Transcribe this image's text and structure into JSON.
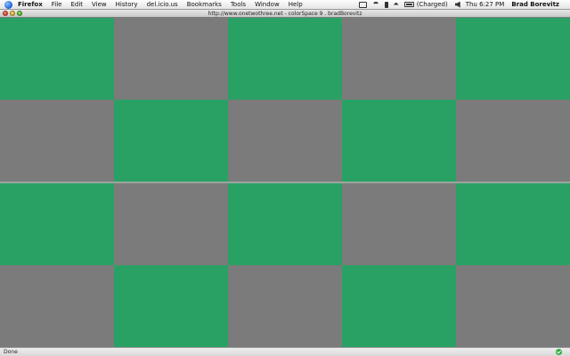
{
  "menubar": {
    "app": "Firefox",
    "items": [
      "File",
      "Edit",
      "View",
      "History",
      "del.icio.us",
      "Bookmarks",
      "Tools",
      "Window",
      "Help"
    ],
    "battery_status": "(Charged)",
    "clock": "Thu 6:27 PM",
    "user": "Brad Borevitz"
  },
  "window": {
    "title": "http://www.onetwothree.net - colorSpace 9 . bradBorevitz"
  },
  "grid": {
    "green": "#2aa164",
    "gray": "#7b7b7b",
    "divider": "#9aa79f",
    "rows": [
      [
        "green",
        "gray",
        "green",
        "gray",
        "green"
      ],
      [
        "gray",
        "green",
        "gray",
        "green",
        "gray"
      ],
      [
        "green",
        "gray",
        "green",
        "gray",
        "green"
      ],
      [
        "gray",
        "green",
        "gray",
        "green",
        "gray"
      ]
    ]
  },
  "statusbar": {
    "text": "Done"
  }
}
